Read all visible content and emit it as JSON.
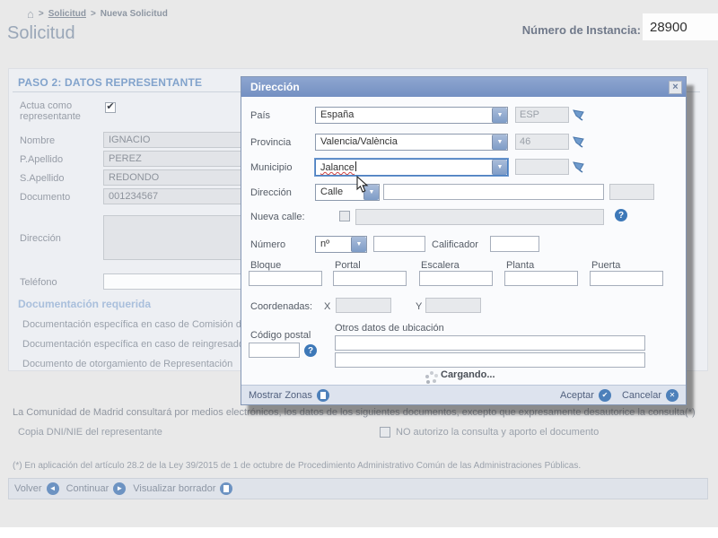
{
  "breadcrumb": {
    "sep": ">",
    "link": "Solicitud",
    "current": "Nueva Solicitud"
  },
  "header": {
    "page_title": "Solicitud",
    "instance_label": "Número de Instancia:",
    "instance_value": "28900"
  },
  "form": {
    "section_title": "PASO 2: DATOS REPRESENTANTE",
    "actua_label": "Actua como representante",
    "nombre_label": "Nombre",
    "nombre_value": "IGNACIO",
    "p_apellido_label": "P.Apellido",
    "p_apellido_value": "PEREZ",
    "s_apellido_label": "S.Apellido",
    "s_apellido_value": "REDONDO",
    "documento_label": "Documento",
    "documento_value": "001234567",
    "direccion_label": "Dirección",
    "telefono_label": "Teléfono",
    "docs_title": "Documentación requerida",
    "docs_items": [
      "Documentación específica en caso de Comisión d",
      "Documentación específica en caso de reingresado",
      "Documento de otorgamiento de Representación"
    ],
    "consent_text": "La Comunidad de Madrid consultará  por medios electrónicos, los datos de los siguientes documentos, excepto que expresamente desautorice la consulta(*)",
    "copia_label": "Copia DNI/NIE del representante",
    "no_autorizo_label": "NO autorizo la consulta y aporto el documento",
    "footnote": "(*) En aplicación del artículo 28.2 de la Ley 39/2015 de 1 de octubre de Procedimiento Administrativo Común de las Administraciones Públicas."
  },
  "nav": {
    "volver": "Volver",
    "continuar": "Continuar",
    "visualizar": "Visualizar borrador"
  },
  "modal": {
    "title": "Dirección",
    "close_glyph": "×",
    "pais_label": "País",
    "pais_value": "España",
    "pais_code": "ESP",
    "provincia_label": "Provincia",
    "provincia_value": "Valencia/València",
    "provincia_code": "46",
    "municipio_label": "Municipio",
    "municipio_value": "Jalance",
    "direccion_label": "Dirección",
    "tipo_via": "Calle",
    "nueva_calle_label": "Nueva calle:",
    "numero_label": "Número",
    "numero_tipo": "nº",
    "calificador_label": "Calificador",
    "bloque_label": "Bloque",
    "portal_label": "Portal",
    "escalera_label": "Escalera",
    "planta_label": "Planta",
    "puerta_label": "Puerta",
    "coordenadas_label": "Coordenadas:",
    "x_label": "X",
    "y_label": "Y",
    "codigo_postal_label": "Código postal",
    "otros_datos_label": "Otros datos de ubicación",
    "cargando_label": "Cargando...",
    "mostrar_zonas_label": "Mostrar Zonas",
    "aceptar_label": "Aceptar",
    "cancelar_label": "Cancelar",
    "arrow_glyph": "▼",
    "check_glyph": "✔",
    "x_glyph": "✕",
    "left_glyph": "◄",
    "right_glyph": "►",
    "help_glyph": "?"
  },
  "colors": {
    "accent": "#3d78b8",
    "modal_header": "#7b96c8",
    "focus_border": "#4a7ec0",
    "error_underline": "#cc4444"
  }
}
